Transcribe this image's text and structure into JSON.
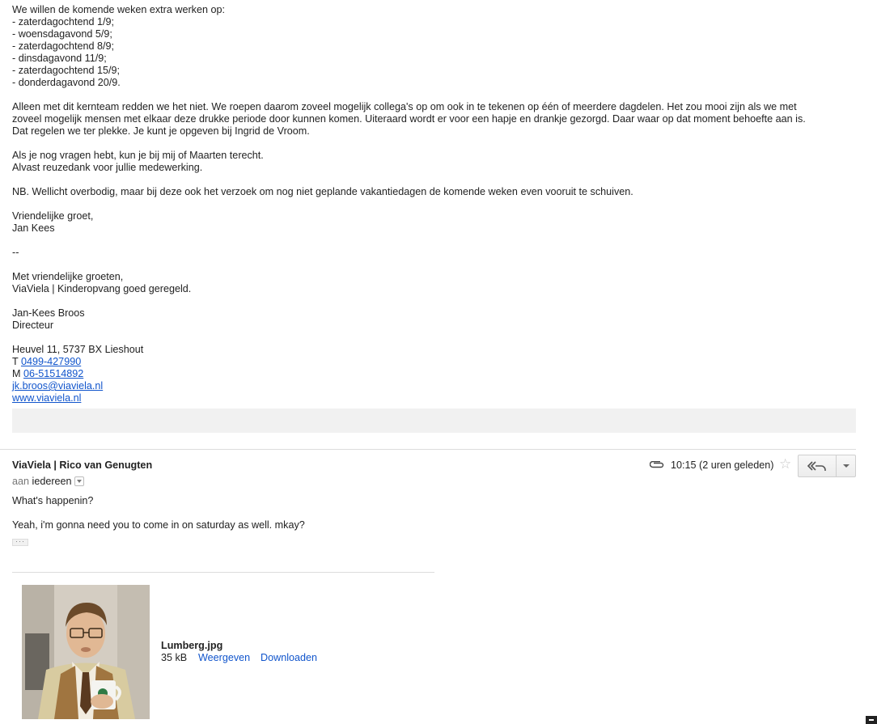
{
  "quoted_message": {
    "lines": [
      "We willen de komende weken extra werken op:",
      "- zaterdagochtend 1/9;",
      "- woensdagavond 5/9;",
      "- zaterdagochtend 8/9;",
      "- dinsdagavond 11/9;",
      "- zaterdagochtend 15/9;",
      "- donderdagavond 20/9."
    ],
    "paragraph_lines": [
      "Alleen met dit kernteam redden we het niet. We roepen daarom zoveel mogelijk collega's op om ook in te tekenen op één of meerdere dagdelen. Het zou mooi zijn als we met",
      "zoveel mogelijk mensen met elkaar deze drukke periode door kunnen komen. Uiteraard wordt er voor een hapje en drankje gezorgd. Daar waar op dat moment behoefte aan is.",
      "Dat regelen we ter plekke. Je kunt je opgeven bij Ingrid de Vroom."
    ],
    "questions_line1": "Als je nog vragen hebt, kun je bij mij of Maarten terecht.",
    "questions_line2": "Alvast reuzedank voor jullie medewerking.",
    "nb": "NB. Wellicht overbodig, maar bij deze ook het verzoek om nog niet geplande vakantiedagen de komende weken even vooruit te schuiven.",
    "greeting": "Vriendelijke groet,",
    "greeting_name": "Jan Kees",
    "sig_separator": "--",
    "sig_closing": "Met vriendelijke groeten,",
    "sig_company": "ViaViela | Kinderopvang goed geregeld.",
    "sig_name": "Jan-Kees Broos",
    "sig_title": "Directeur",
    "sig_address": "Heuvel 11, 5737 BX Lieshout",
    "sig_phone_label": "T",
    "sig_phone": "0499-427990",
    "sig_mobile_label": "M",
    "sig_mobile": "06-51514892",
    "sig_email": "jk.broos@viaviela.nl",
    "sig_web": "www.viaviela.nl"
  },
  "reply": {
    "sender": "ViaViela | Rico van Genugten",
    "to_prefix": "aan",
    "to": "iedereen",
    "time": "10:15 (2 uren geleden)",
    "body_line1": "What's happenin?",
    "body_line2": "Yeah, i'm gonna need you to come in on saturday as well. mkay?",
    "ellipsis": "···",
    "attachment": {
      "filename": "Lumberg.jpg",
      "size": "35 kB",
      "view_label": "Weergeven",
      "download_label": "Downloaden"
    }
  },
  "colors": {
    "link": "#1155cc",
    "text": "#222222",
    "muted": "#777777",
    "divider": "#dcdcdc"
  },
  "icons": [
    "paperclip-icon",
    "star-icon",
    "reply-icon",
    "dropdown-icon"
  ]
}
